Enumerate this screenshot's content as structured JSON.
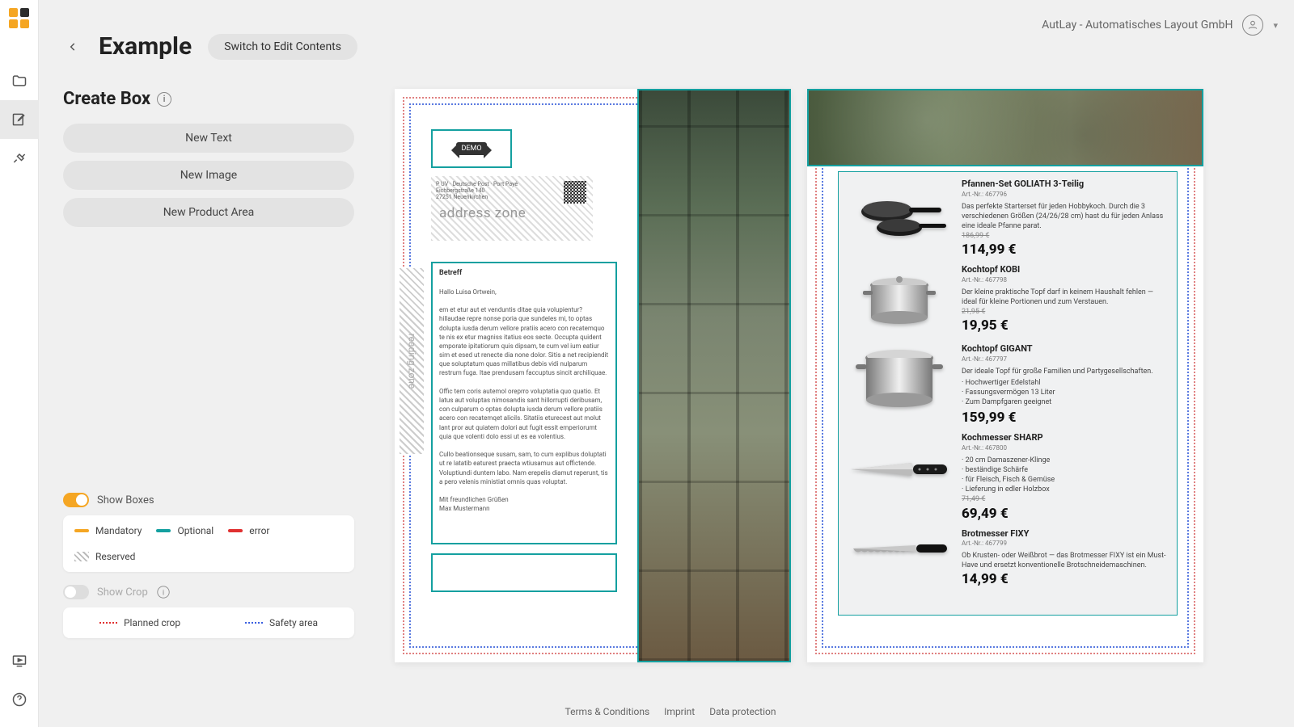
{
  "topbar": {
    "company": "AutLay - Automatisches Layout GmbH"
  },
  "header": {
    "title": "Example",
    "switch_btn": "Switch to Edit Contents"
  },
  "create_box": {
    "title": "Create Box",
    "btn_text": "New Text",
    "btn_image": "New Image",
    "btn_product": "New Product Area"
  },
  "toggles": {
    "show_boxes": "Show Boxes",
    "show_crop": "Show Crop"
  },
  "legend_boxes": {
    "mandatory": "Mandatory",
    "optional": "Optional",
    "error": "error",
    "reserved": "Reserved"
  },
  "legend_crop": {
    "planned": "Planned crop",
    "safety": "Safety area"
  },
  "footer": {
    "terms": "Terms & Conditions",
    "imprint": "Imprint",
    "data": "Data protection"
  },
  "pageA": {
    "demo_label": "DEMO",
    "addr_zone_label": "address zone",
    "addr_lines": "P UV · Deutsche Post · Port Payé\nEichbergstraße 140\n27251 Neuenkirchen",
    "reserved_label": "reading zone",
    "letter": {
      "subject": "Betreff",
      "greeting": "Hallo Luisa Ortwein,",
      "p1": "em et etur aut et venduntis ditae quia volupientur? hillaudae repre nonse poria que sundeles mi, to optas dolupta iusda derum vellore pratiis acero con recatemquo te nis ex etur magniss itatius eos secte. Occupta quident emporate ipitatiorum quis dipsam, te cum vel ium eatiur sim et esed ut renecte dia none dolor. Sitis a net recipiendit que soluptatum quas millatibus debis vidi nulparum restrum fuga. Itae prendusam faccuptus sincit archiliquae.",
      "p2": "Offic tem coris autemol oreprro voluptatia quo quatio. Et latus aut voluptas nimosandis sant hillorrupti deribusam, con culparum o optas dolupta iusda derum vellore pratiis acero con recatemqet alicils. Sitatiis eturecest aut molut lant pror aut quiatem dolori aut fugit essit emperiorumt quia que volenti dolo essi ut es ea volentius.",
      "p3": "Cullo beationseque susam, sam, to cum explibus doluptati ut re latatib eaturest praecta wtiusamus aut offictende. Voluptiundi duntem labo. Nam erepelis diamut reperunt, tis a pero velenis ministiat omnis quas voluptat.",
      "closing": "Mit freundlichen Grüßen",
      "signature": "Max Mustermann"
    }
  },
  "pageB": {
    "products": [
      {
        "name": "Pfannen-Set GOLIATH 3-Teilig",
        "art": "Art.-Nr.: 467796",
        "desc": "Das perfekte Starterset für jeden Hobbykoch. Durch die 3 verschiedenen Größen (24/26/28 cm) hast du für jeden Anlass eine ideale Pfanne parat.",
        "old_price": "186,99 €",
        "price": "114,99 €"
      },
      {
        "name": "Kochtopf KOBI",
        "art": "Art.-Nr.: 467798",
        "desc": "Der kleine praktische Topf darf in keinem Haushalt fehlen — ideal für kleine Portionen und zum Verstauen.",
        "old_price": "21,95 €",
        "price": "19,95 €"
      },
      {
        "name": "Kochtopf GIGANT",
        "art": "Art.-Nr.: 467797",
        "desc": "Der ideale Topf für große Familien und Partygesellschaften.",
        "bullets": "· Hochwertiger Edelstahl\n· Fassungsvermögen 13 Liter\n· Zum Dampfgaren geeignet",
        "price": "159,99 €"
      },
      {
        "name": "Kochmesser SHARP",
        "art": "Art.-Nr.: 467800",
        "bullets": "· 20 cm Damaszener-Klinge\n· beständige Schärfe\n· für Fleisch, Fisch & Gemüse\n· Lieferung in edler Holzbox",
        "old_price": "71,49 €",
        "price": "69,49 €"
      },
      {
        "name": "Brotmesser FIXY",
        "art": "Art.-Nr.: 467799",
        "desc": "Ob Krusten- oder Weißbrot — das Brotmesser FIXY ist ein Must-Have und ersetzt konventionelle Brotschneidemaschinen.",
        "price": "14,99 €"
      }
    ]
  }
}
